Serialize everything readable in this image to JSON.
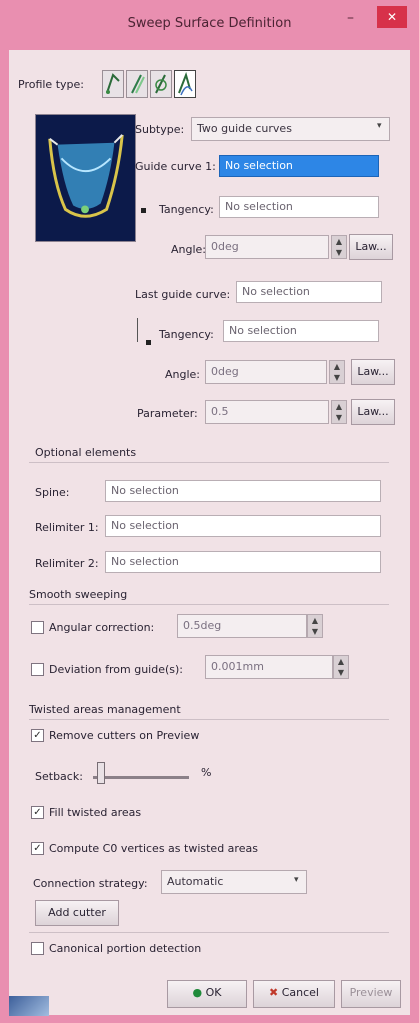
{
  "window": {
    "title": "Sweep Surface Definition",
    "min_glyph": "–",
    "close_glyph": "✕"
  },
  "profile_type": {
    "label": "Profile type:",
    "icons": [
      "explicit-profile-icon",
      "line-profile-icon",
      "circle-profile-icon",
      "conic-profile-icon"
    ]
  },
  "subtype": {
    "label": "Subtype:",
    "value": "Two guide curves"
  },
  "guide_curve_1": {
    "label": "Guide curve 1:",
    "value": "No selection"
  },
  "tangency_1": {
    "label": "Tangency:",
    "value": "No selection"
  },
  "angle_1": {
    "label": "Angle:",
    "value": "0deg",
    "law_label": "Law..."
  },
  "last_guide_curve": {
    "label": "Last guide curve:",
    "value": "No selection"
  },
  "tangency_2": {
    "label": "Tangency:",
    "value": "No selection"
  },
  "angle_2": {
    "label": "Angle:",
    "value": "0deg",
    "law_label": "Law..."
  },
  "parameter": {
    "label": "Parameter:",
    "value": "0.5",
    "law_label": "Law..."
  },
  "optional_elements": {
    "header": "Optional elements",
    "spine": {
      "label": "Spine:",
      "value": "No selection"
    },
    "relimiter_1": {
      "label": "Relimiter 1:",
      "value": "No selection"
    },
    "relimiter_2": {
      "label": "Relimiter 2:",
      "value": "No selection"
    }
  },
  "smooth_sweeping": {
    "header": "Smooth sweeping",
    "angular_correction": {
      "label": "Angular correction:",
      "value": "0.5deg",
      "checked": false
    },
    "deviation": {
      "label": "Deviation from guide(s):",
      "value": "0.001mm",
      "checked": false
    }
  },
  "twisted_areas": {
    "header": "Twisted areas management",
    "remove_cutters": {
      "label": "Remove cutters on Preview",
      "checked": true
    },
    "setback": {
      "label": "Setback:",
      "unit": "%",
      "value_fraction": 0.05
    },
    "fill_twisted": {
      "label": "Fill twisted areas",
      "checked": true
    },
    "compute_c0": {
      "label": "Compute C0 vertices as twisted areas",
      "checked": true
    },
    "connection_strategy": {
      "label": "Connection strategy:",
      "value": "Automatic"
    },
    "add_cutter": "Add cutter"
  },
  "canonical": {
    "label": "Canonical portion detection",
    "checked": false
  },
  "footer": {
    "ok": "OK",
    "cancel": "Cancel",
    "preview": "Preview"
  }
}
